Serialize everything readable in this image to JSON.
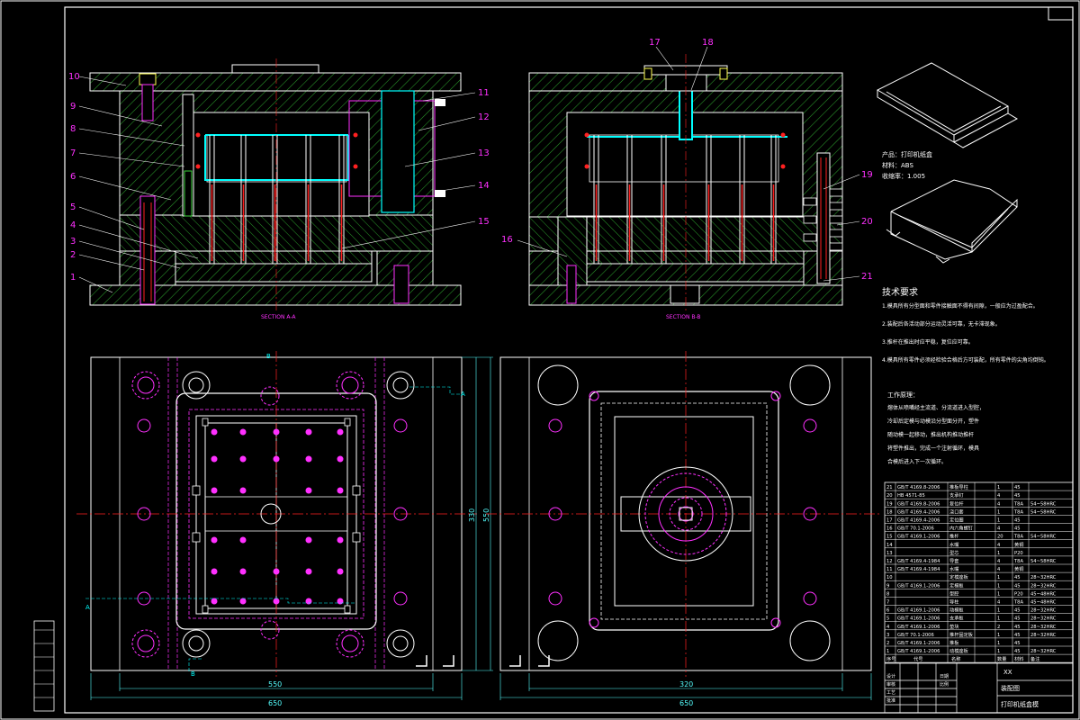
{
  "section_labels": {
    "aa": "SECTION A-A",
    "bb": "SECTION B-B"
  },
  "leaders_left": [
    "10",
    "9",
    "8",
    "7",
    "6",
    "5",
    "4",
    "3",
    "2",
    "1"
  ],
  "leaders_mid": [
    "11",
    "12",
    "13",
    "14",
    "15"
  ],
  "leaders_right_top": [
    "17",
    "18"
  ],
  "leaders_right": [
    "16",
    "19",
    "20",
    "21"
  ],
  "cut_markers": {
    "a": "A",
    "b": "B"
  },
  "product_info": {
    "name": "产品：打印机纸盒",
    "material": "材料：ABS",
    "shrink": "收缩率：1.005"
  },
  "tech_req": {
    "title": "技术要求",
    "lines": [
      "1.模具所有分型面和零件接触面不得有间隙，一般应为过盈配合。",
      "2.装配后各活动部分运动灵活可靠，无卡滞现象。",
      "3.推杆在推出时应平稳，复位应可靠。",
      "4.模具所有零件必须经检验合格后方可装配，所有零件的尖角均倒钝。"
    ]
  },
  "work_principle": {
    "title": "工作原理：",
    "lines": [
      "熔体从喷嘴经主流道、分流道进入型腔，",
      "冷却后定模与动模沿分型面分开，塑件",
      "随动模一起移动，推出机构推动推杆",
      "将塑件推出，完成一个注射循环，模具",
      "合模后进入下一次循环。"
    ]
  },
  "dimensions": {
    "w_inner_left": "550",
    "w_outer_left": "650",
    "h_inner_left": "330",
    "h_outer_left": "550",
    "w_inner_right": "320",
    "w_outer_right": "650"
  },
  "bom": [
    [
      "21",
      "GB/T 4169.8-2006",
      "推板导柱",
      "1",
      "45",
      ""
    ],
    [
      "20",
      "HB 4571-85",
      "支承钉",
      "4",
      "45",
      ""
    ],
    [
      "19",
      "GB/T 4169.8-2006",
      "复位杆",
      "4",
      "T8A",
      "54~58HRC"
    ],
    [
      "18",
      "GB/T 4169.4-2006",
      "浇口套",
      "1",
      "T8A",
      "54~58HRC"
    ],
    [
      "17",
      "GB/T 4169.4-2006",
      "定位圈",
      "1",
      "45",
      ""
    ],
    [
      "16",
      "GB/T 70.1-2006",
      "内六角螺钉",
      "4",
      "45",
      ""
    ],
    [
      "15",
      "GB/T 4169.1-2006",
      "推杆",
      "20",
      "T8A",
      "54~58HRC"
    ],
    [
      "14",
      "",
      "水嘴",
      "4",
      "黄铜",
      ""
    ],
    [
      "13",
      "",
      "型芯",
      "1",
      "P20",
      ""
    ],
    [
      "12",
      "GB/T 4169.4-1984",
      "导套",
      "4",
      "T8A",
      "54~58HRC"
    ],
    [
      "11",
      "GB/T 4169.4-1984",
      "水嘴",
      "4",
      "黄铜",
      ""
    ],
    [
      "10",
      "",
      "定模座板",
      "1",
      "45",
      "28~32HRC"
    ],
    [
      "9",
      "GB/T 4169.1-2006",
      "定模板",
      "1",
      "45",
      "28~32HRC"
    ],
    [
      "8",
      "",
      "型腔",
      "1",
      "P20",
      "45~48HRC"
    ],
    [
      "7",
      "",
      "导柱",
      "4",
      "T8A",
      "45~48HRC"
    ],
    [
      "6",
      "GB/T 4169.1-2006",
      "动模板",
      "1",
      "45",
      "28~32HRC"
    ],
    [
      "5",
      "GB/T 4169.1-2006",
      "支承板",
      "1",
      "45",
      "28~32HRC"
    ],
    [
      "4",
      "GB/T 4169.1-2006",
      "垫块",
      "2",
      "45",
      "28~32HRC"
    ],
    [
      "3",
      "GB/T 70.1-2006",
      "推杆固定板",
      "1",
      "45",
      "28~32HRC"
    ],
    [
      "2",
      "GB/T 4169.1-2006",
      "推板",
      "1",
      "45",
      ""
    ],
    [
      "1",
      "GB/T 4169.1-2006",
      "动模座板",
      "1",
      "45",
      "28~32HRC"
    ]
  ],
  "bom_header": [
    "序号",
    "代号",
    "名称",
    "数量",
    "材料",
    "备注"
  ],
  "title_block": {
    "drawing_name": "装配图",
    "product": "打印机纸盒模",
    "school": "XX"
  },
  "stamp_rows": [
    "设计",
    "审核",
    "工艺",
    "批准",
    "日期",
    "比例"
  ],
  "colors": {
    "line": "#ffffff",
    "green": "#3cd23c",
    "magenta": "#ff30ff",
    "cyan": "#00ffff",
    "red": "#ff2020",
    "yellow": "#ffff50",
    "dim": "#55ffff"
  }
}
